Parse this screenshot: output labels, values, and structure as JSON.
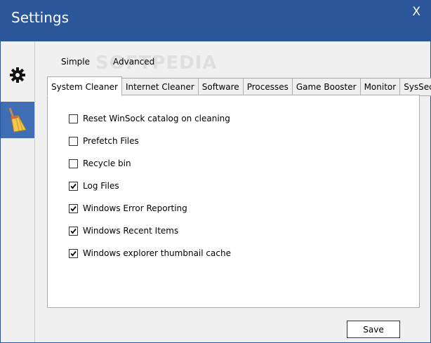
{
  "window": {
    "title": "Settings",
    "close_label": "X",
    "watermark": "SOFTPEDIA"
  },
  "sidebar": {
    "items": [
      {
        "icon": "gear-icon"
      },
      {
        "icon": "broom-icon"
      }
    ]
  },
  "modes": {
    "simple": "Simple",
    "advanced": "Advanced"
  },
  "tabs": [
    "System Cleaner",
    "Internet Cleaner",
    "Software",
    "Processes",
    "Game Booster",
    "Monitor",
    "SysSecure"
  ],
  "options": [
    {
      "label": "Reset WinSock catalog on cleaning",
      "checked": false
    },
    {
      "label": "Prefetch Files",
      "checked": false
    },
    {
      "label": "Recycle bin",
      "checked": false
    },
    {
      "label": "Log Files",
      "checked": true
    },
    {
      "label": "Windows Error Reporting",
      "checked": true
    },
    {
      "label": "Windows Recent Items",
      "checked": true
    },
    {
      "label": "Windows explorer thumbnail cache",
      "checked": true
    }
  ],
  "footer": {
    "save_label": "Save"
  },
  "colors": {
    "titlebar": "#2b579a",
    "active_sidebar": "#3f6eb4"
  }
}
